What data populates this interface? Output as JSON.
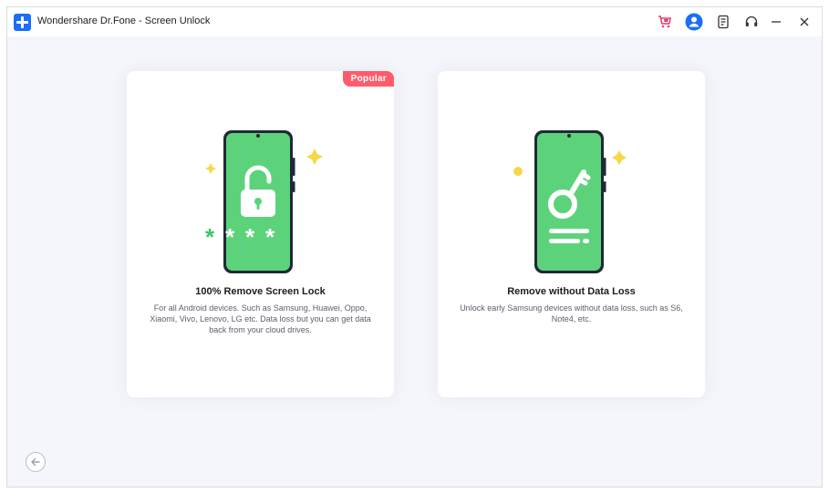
{
  "app": {
    "title": "Wondershare Dr.Fone - Screen Unlock"
  },
  "header": {
    "icons": [
      "cart-icon",
      "user-avatar-icon",
      "feedback-icon",
      "support-headset-icon",
      "minimize-icon",
      "close-icon"
    ]
  },
  "options": [
    {
      "badge": "Popular",
      "title": "100% Remove Screen Lock",
      "description": "For all Android devices. Such as Samsung, Huawei, Oppo, Xiaomi, Vivo, Lenovo, LG etc. Data loss but you can get data back from your cloud drives.",
      "icon": "phone-unlock-icon"
    },
    {
      "title": "Remove without Data Loss",
      "description": "Unlock early Samsung devices without data loss, such as S6, Note4, etc.",
      "icon": "phone-key-icon"
    }
  ],
  "footer": {
    "back_icon": "back-arrow-icon"
  },
  "colors": {
    "accent": "#1a6ef7",
    "badge": "#ff5b6a",
    "phone_green": "#5cd37a",
    "sparkle": "#f5d84a"
  }
}
